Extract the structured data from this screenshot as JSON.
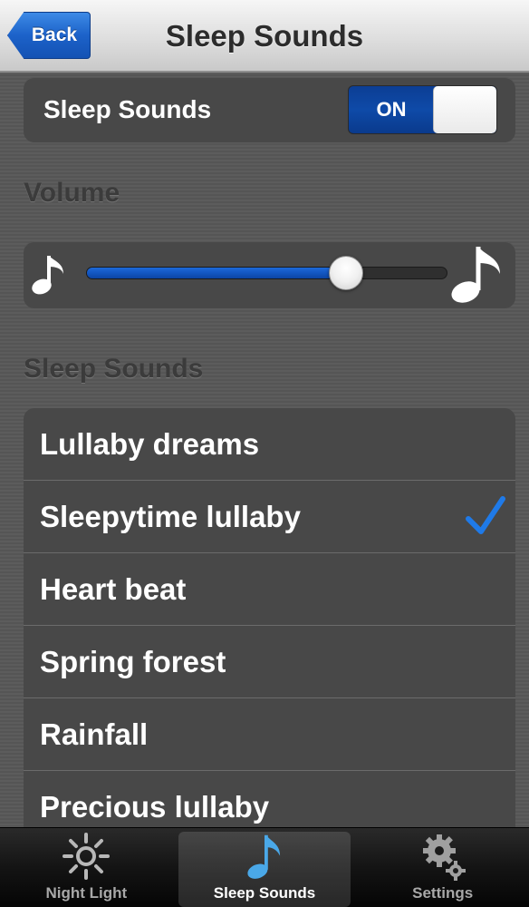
{
  "navbar": {
    "back_label": "Back",
    "title": "Sleep Sounds"
  },
  "toggle": {
    "label": "Sleep Sounds",
    "state_label": "ON",
    "is_on": true
  },
  "volume": {
    "heading": "Volume",
    "level": 0.72
  },
  "sounds": {
    "heading": "Sleep Sounds",
    "items": [
      {
        "label": "Lullaby dreams",
        "selected": false
      },
      {
        "label": "Sleepytime lullaby",
        "selected": true
      },
      {
        "label": "Heart beat",
        "selected": false
      },
      {
        "label": "Spring forest",
        "selected": false
      },
      {
        "label": "Rainfall",
        "selected": false
      },
      {
        "label": "Precious lullaby",
        "selected": false
      }
    ]
  },
  "tabbar": {
    "tabs": [
      {
        "label": "Night Light",
        "icon": "sun-icon",
        "selected": false
      },
      {
        "label": "Sleep Sounds",
        "icon": "music-note-icon",
        "selected": true
      },
      {
        "label": "Settings",
        "icon": "gears-icon",
        "selected": false
      }
    ]
  },
  "colors": {
    "accent": "#1a5fcc",
    "check": "#1f7ae8",
    "selected_tab_icon": "#4aa8e8"
  }
}
